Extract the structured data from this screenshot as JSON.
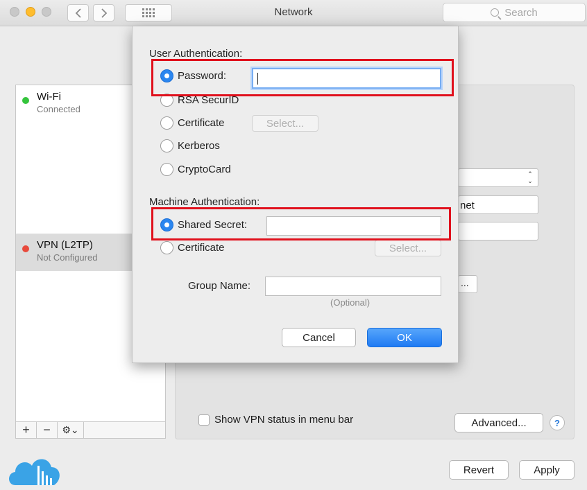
{
  "window": {
    "title": "Network"
  },
  "search": {
    "placeholder": "Search"
  },
  "sidebar": {
    "items": [
      {
        "name": "Wi-Fi",
        "status": "Connected",
        "dot_color": "#34c43c"
      },
      {
        "name": "VPN (L2TP)",
        "status": "Not Configured",
        "dot_color": "#e84a3c"
      }
    ],
    "toolbar": {
      "add": "+",
      "remove": "−",
      "gear": "⚙⌄"
    }
  },
  "background": {
    "field_partial_text": "net",
    "select_arrows": "⌃⌄",
    "button_partial_text": "...",
    "show_vpn_status_label": "Show VPN status in menu bar",
    "advanced_label": "Advanced...",
    "help_label": "?",
    "revert_label": "Revert",
    "apply_label": "Apply"
  },
  "dialog": {
    "user_auth_label": "User Authentication:",
    "user_auth_options": [
      {
        "label": "Password:",
        "selected": true
      },
      {
        "label": "RSA SecurID",
        "selected": false
      },
      {
        "label": "Certificate",
        "selected": false
      },
      {
        "label": "Kerberos",
        "selected": false
      },
      {
        "label": "CryptoCard",
        "selected": false
      }
    ],
    "password_value": "",
    "user_cert_select_label": "Select...",
    "machine_auth_label": "Machine Authentication:",
    "machine_auth_options": [
      {
        "label": "Shared Secret:",
        "selected": true
      },
      {
        "label": "Certificate",
        "selected": false
      }
    ],
    "shared_secret_value": "",
    "machine_cert_select_label": "Select...",
    "group_name_label": "Group Name:",
    "group_name_value": "",
    "optional_hint": "(Optional)",
    "cancel_label": "Cancel",
    "ok_label": "OK"
  },
  "colors": {
    "accent": "#2b86ef",
    "highlight": "#e0101c"
  }
}
